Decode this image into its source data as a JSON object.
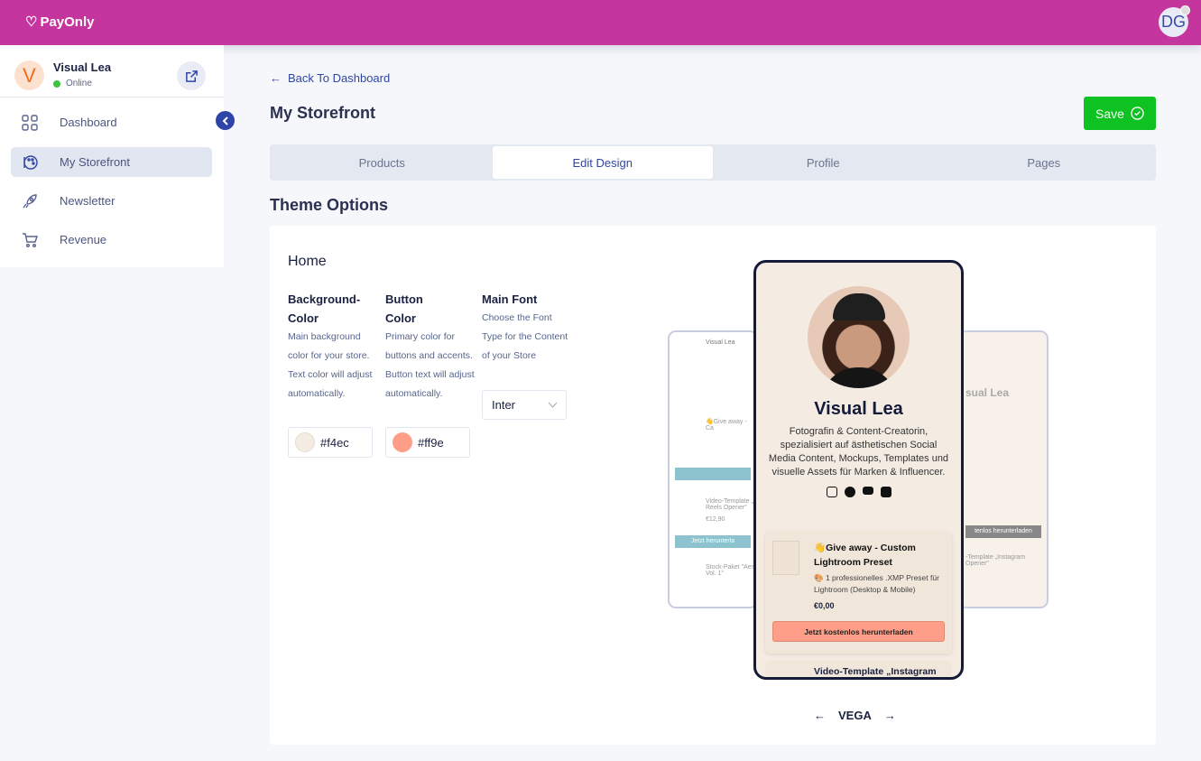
{
  "app": {
    "name": "PayOnly",
    "user_initials": "DG"
  },
  "sidebar": {
    "user_initial": "V",
    "user_name": "Visual Lea",
    "status": "Online",
    "items": [
      {
        "label": "Dashboard"
      },
      {
        "label": "My Storefront"
      },
      {
        "label": "Newsletter"
      },
      {
        "label": "Revenue"
      }
    ]
  },
  "header": {
    "back": "Back To Dashboard",
    "title": "My Storefront",
    "save": "Save"
  },
  "tabs": [
    {
      "label": "Products"
    },
    {
      "label": "Edit Design"
    },
    {
      "label": "Profile"
    },
    {
      "label": "Pages"
    }
  ],
  "theme": {
    "heading": "Theme Options",
    "section": "Home",
    "bg": {
      "title1": "Background-",
      "title2": "Color",
      "desc": "Main background color for your store. Text color will adjust automatically.",
      "value": "#f4ec",
      "swatch": "#f4ece2"
    },
    "btn": {
      "title1": "Button",
      "title2": "Color",
      "desc": "Primary color for buttons and accents. Button text will adjust automatically.",
      "value": "#ff9e",
      "swatch": "#ff9e88"
    },
    "font": {
      "title": "Main Font",
      "desc": "Choose the Font Type for the Content of your Store",
      "value": "Inter"
    }
  },
  "preview": {
    "name": "Visual Lea",
    "bio": "Fotografin & Content-Creatorin, spezialisiert auf ästhetischen Social Media Content, Mockups, Templates und visuelle Assets für Marken & Influencer.",
    "product1": {
      "title": "👋Give away - Custom Lightroom Preset",
      "desc": "🎨 1 professionelles .XMP Preset für Lightroom (Desktop & Mobile)",
      "price": "€0,00",
      "button": "Jetzt kostenlos herunterladen"
    },
    "product2": {
      "title": "Video-Template „Instagram"
    },
    "left": {
      "name": "Visual Lea",
      "p1": "👋Give away - Ca",
      "p2": "Video-Template „ Reels Opener\"",
      "price2": "€12,90",
      "btn2": "Jetzt herunterla",
      "p3": "Stock-Paket \"Aes Vol. 1\""
    },
    "right": {
      "name": "sual Lea",
      "btn": "tenlos herunterladen",
      "p": "-Template „Instagram Opener\""
    },
    "theme_name": "VEGA"
  }
}
